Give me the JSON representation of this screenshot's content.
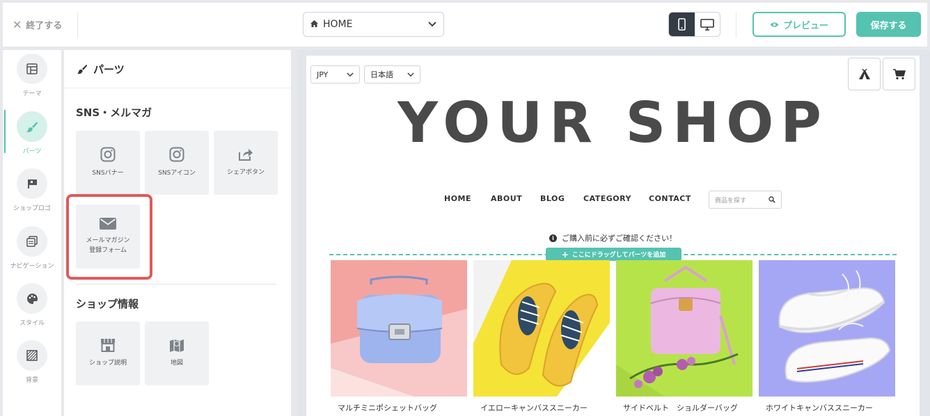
{
  "topbar": {
    "exit_label": "終了する",
    "page_select": "HOME",
    "preview_label": "プレビュー",
    "save_label": "保存する"
  },
  "rail": {
    "items": [
      {
        "label": "テーマ",
        "icon": "layout-icon"
      },
      {
        "label": "パーツ",
        "icon": "brush-icon",
        "active": true
      },
      {
        "label": "ショップロゴ",
        "icon": "flag-icon"
      },
      {
        "label": "ナビゲーション",
        "icon": "navigation-icon"
      },
      {
        "label": "スタイル",
        "icon": "palette-icon"
      },
      {
        "label": "背景",
        "icon": "background-icon"
      }
    ]
  },
  "panel": {
    "title": "パーツ",
    "sns_section": "SNS・メルマガ",
    "sns_tiles": [
      "SNSバナー",
      "SNSアイコン",
      "シェアボタン"
    ],
    "newsletter_tile_line1": "メールマガジン",
    "newsletter_tile_line2": "登録フォーム",
    "shop_section": "ショップ情報",
    "shop_tiles": [
      "ショップ説明",
      "地図"
    ]
  },
  "preview": {
    "currency": "JPY",
    "language": "日本語",
    "shop_title": "YOUR SHOP",
    "nav": [
      "HOME",
      "ABOUT",
      "BLOG",
      "CATEGORY",
      "CONTACT"
    ],
    "search_placeholder": "商品を探す",
    "notice": "ご購入前に必ずご確認ください！",
    "drop_label": "ここにドラッグしてパーツを追加",
    "products": [
      {
        "name": "マルチミニポシェットバッグ",
        "bg": "#f3a4a0"
      },
      {
        "name": "イエローキャンバススニーカー",
        "bg": "#f5e337"
      },
      {
        "name": "サイドベルト　ショルダーバッグ",
        "bg": "#b7e34a"
      },
      {
        "name": "ホワイトキャンバススニーカー",
        "bg": "#a5a7f5"
      }
    ]
  },
  "colors": {
    "accent": "#55c3b0",
    "highlight": "#e05a5a",
    "dark": "#343c46"
  }
}
